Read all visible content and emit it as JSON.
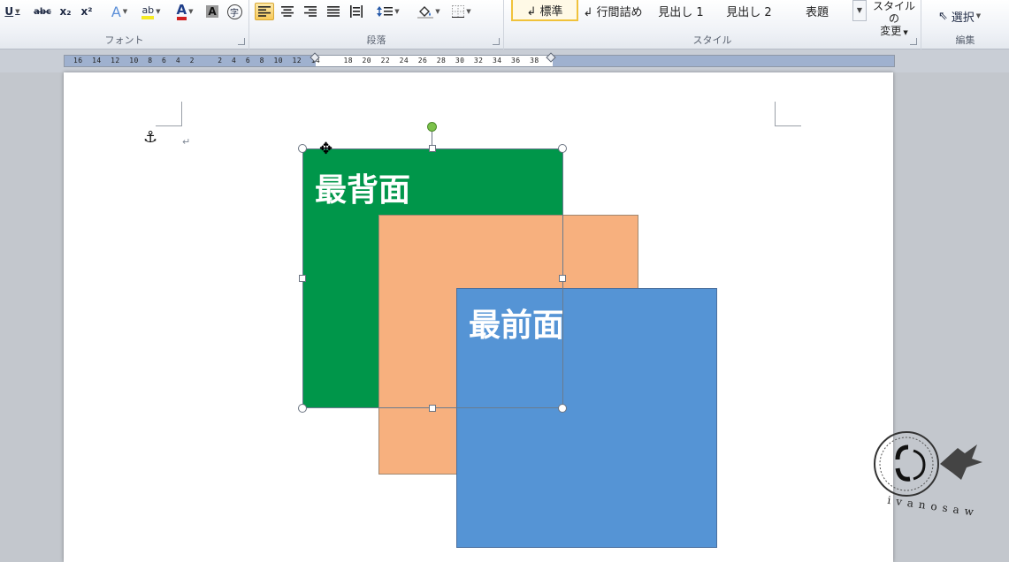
{
  "ribbon": {
    "font_group": {
      "label": "フォント",
      "buttons": {
        "underline": "U",
        "strikethrough": "abc",
        "subscript": "x₂",
        "superscript": "x²",
        "text_effect": "A",
        "highlight": "ab",
        "font_color": "A",
        "char_shading": "A",
        "enclose": "字"
      }
    },
    "paragraph_group": {
      "label": "段落"
    },
    "styles_group": {
      "label": "スタイル",
      "items": [
        "↲ 標準",
        "↲ 行間詰め",
        "見出し 1",
        "見出し 2",
        "表題"
      ],
      "selected": "↲ 標準",
      "change_styles_line1": "スタイルの",
      "change_styles_line2": "変更"
    },
    "editing_group": {
      "label": "編集",
      "select_label": "選択"
    }
  },
  "ruler": {
    "text": "16  14  12  10  8  6  4  2     2  4  6  8  10  12  14     18  20  22  24  26  28  30  32  34  36  38"
  },
  "document": {
    "shapes": {
      "back_label": "最背面",
      "front_label": "最前面"
    },
    "para_mark": "↵",
    "colors": {
      "green": "#00964a",
      "orange": "#f7b07e",
      "blue": "#5594d5"
    }
  },
  "watermark": {
    "text": "ivanosaw"
  }
}
